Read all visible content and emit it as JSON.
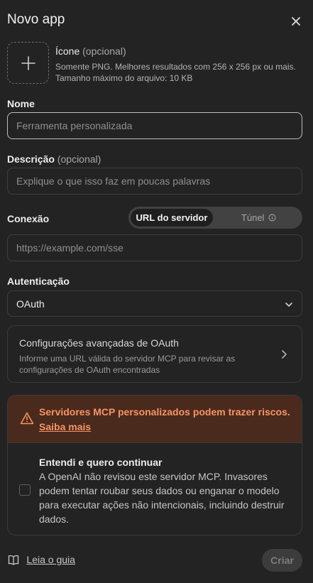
{
  "dialog": {
    "title": "Novo app"
  },
  "icon": {
    "label": "Ícone",
    "optional": "(opcional)",
    "help": "Somente PNG. Melhores resultados com 256 x 256 px ou mais. Tamanho máximo do arquivo: 10 KB"
  },
  "name": {
    "label": "Nome",
    "placeholder": "Ferramenta personalizada"
  },
  "description": {
    "label": "Descrição",
    "optional": "(opcional)",
    "placeholder": "Explique o que isso faz em poucas palavras"
  },
  "connection": {
    "label": "Conexão",
    "options": [
      "URL do servidor",
      "Túnel"
    ],
    "selected": "URL do servidor",
    "placeholder": "https://example.com/sse"
  },
  "auth": {
    "label": "Autenticação",
    "value": "OAuth"
  },
  "advanced": {
    "title": "Configurações avançadas de OAuth",
    "description": "Informe uma URL válida do servidor MCP para revisar as configurações de OAuth encontradas"
  },
  "warning": {
    "message": "Servidores MCP personalizados podem trazer riscos.",
    "link": "Saiba mais",
    "ack_title": "Entendi e quero continuar",
    "ack_body": "A OpenAI não revisou este servidor MCP. Invasores podem tentar roubar seus dados ou enganar o modelo para executar ações não intencionais, incluindo destruir dados.",
    "checked": false
  },
  "footer": {
    "guide": "Leia o guia",
    "create": "Criar"
  },
  "colors": {
    "background": "#232323",
    "warning_text": "#f59466",
    "warning_bg": "#4a2a1c"
  },
  "icons": [
    "close-icon",
    "plus-icon",
    "info-icon",
    "chevron-down-icon",
    "chevron-right-icon",
    "warning-icon",
    "book-icon"
  ]
}
